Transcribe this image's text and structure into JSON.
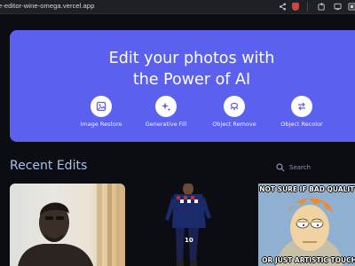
{
  "browser": {
    "url": "e-editor-wine-omega.vercel.app",
    "icons": [
      "share-icon",
      "shield-icon",
      "extensions-icon",
      "cast-icon",
      "menu-icon"
    ]
  },
  "hero": {
    "title_line1": "Edit your photos with",
    "title_line2": "the Power of AI",
    "accent_color": "#5b60ee",
    "tools": [
      {
        "label": "Image Restore",
        "icon": "image-restore-icon"
      },
      {
        "label": "Generative Fill",
        "icon": "sparkles-icon"
      },
      {
        "label": "Object Remove",
        "icon": "object-remove-icon"
      },
      {
        "label": "Object Recolor",
        "icon": "recolor-icon"
      }
    ]
  },
  "recent": {
    "title": "Recent Edits",
    "search_label": "Search",
    "cards": [
      {
        "kind": "portrait photo"
      },
      {
        "kind": "soccer player cutout"
      },
      {
        "kind": "meme",
        "top_text": "NOT SURE IF BAD QUALITY",
        "bottom_text": "OR JUST ARTISTIC TOUCH"
      }
    ]
  }
}
